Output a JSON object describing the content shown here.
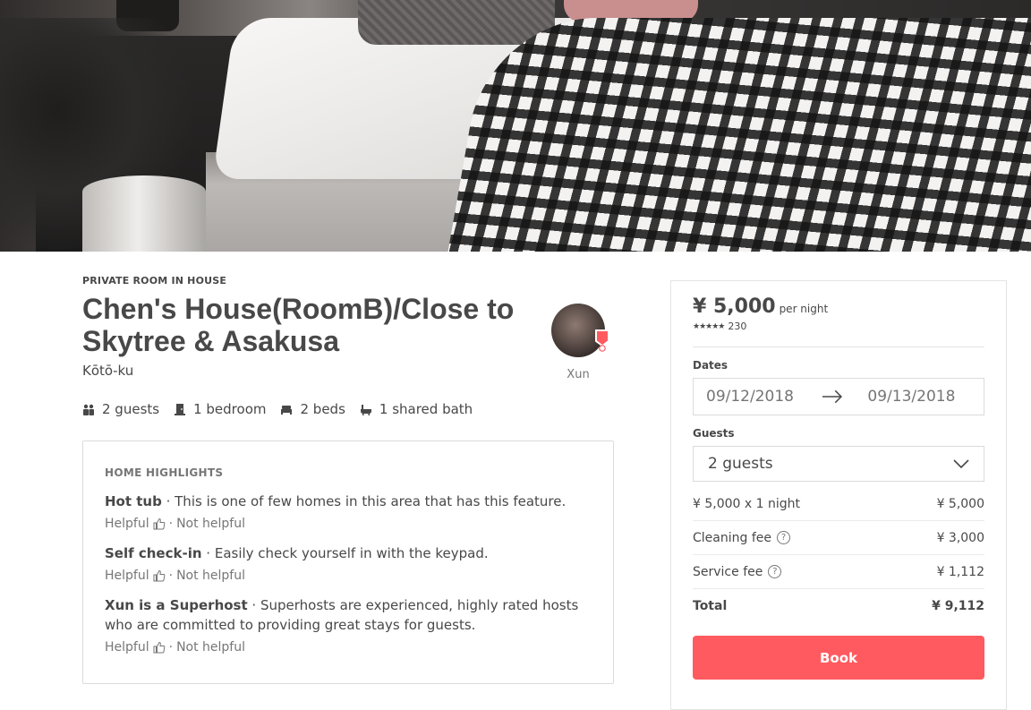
{
  "listing": {
    "room_type": "PRIVATE ROOM IN HOUSE",
    "title": "Chen's House(RoomB)/Close to Skytree & Asakusa",
    "location": "Kōtō-ku",
    "host": {
      "name": "Xun",
      "avatar_icon": "host-avatar",
      "badge_icon": "superhost-badge-icon"
    },
    "amenities": [
      {
        "icon": "guests-icon",
        "label": "2 guests"
      },
      {
        "icon": "door-icon",
        "label": "1 bedroom"
      },
      {
        "icon": "bed-icon",
        "label": "2 beds"
      },
      {
        "icon": "bath-icon",
        "label": "1 shared bath"
      }
    ]
  },
  "highlights": {
    "header": "HOME HIGHLIGHTS",
    "items": [
      {
        "name": "Hot tub",
        "description": " · This is one of few homes in this area that has this feature."
      },
      {
        "name": "Self check-in",
        "description": " · Easily check yourself in with the keypad."
      },
      {
        "name": "Xun is a Superhost",
        "description": " · Superhosts are experienced, highly rated hosts who are committed to providing great stays for guests."
      }
    ],
    "helpful_label": "Helpful",
    "separator": "·",
    "not_helpful_label": "Not helpful"
  },
  "booking": {
    "price": "¥ 5,000",
    "per_night": "per night",
    "stars": "★★★★★",
    "rating_count": "230",
    "dates_label": "Dates",
    "check_in": "09/12/2018",
    "check_out": "09/13/2018",
    "guests_label": "Guests",
    "guests_value": "2 guests",
    "fees": [
      {
        "label": "¥ 5,000 x 1 night",
        "value": "¥ 5,000",
        "info": false
      },
      {
        "label": "Cleaning fee",
        "value": "¥ 3,000",
        "info": true
      },
      {
        "label": "Service fee",
        "value": "¥ 1,112",
        "info": true
      }
    ],
    "total_label": "Total",
    "total_value": "¥ 9,112",
    "book_label": "Book",
    "accent_color": "#ff5a5f"
  }
}
